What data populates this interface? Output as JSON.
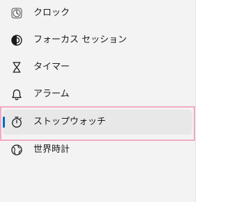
{
  "nav": {
    "items": [
      {
        "label": "クロック",
        "icon": "clock-icon"
      },
      {
        "label": "フォーカス セッション",
        "icon": "focus-session-icon"
      },
      {
        "label": "タイマー",
        "icon": "hourglass-icon"
      },
      {
        "label": "アラーム",
        "icon": "bell-icon"
      },
      {
        "label": "ストップウォッチ",
        "icon": "stopwatch-icon",
        "selected": true
      },
      {
        "label": "世界時計",
        "icon": "globe-icon"
      }
    ]
  },
  "colors": {
    "accent": "#0067c0",
    "highlight_border": "#f3a9c7",
    "sidebar_bg": "#f3f3f3",
    "selected_bg": "#e8e8e8"
  }
}
